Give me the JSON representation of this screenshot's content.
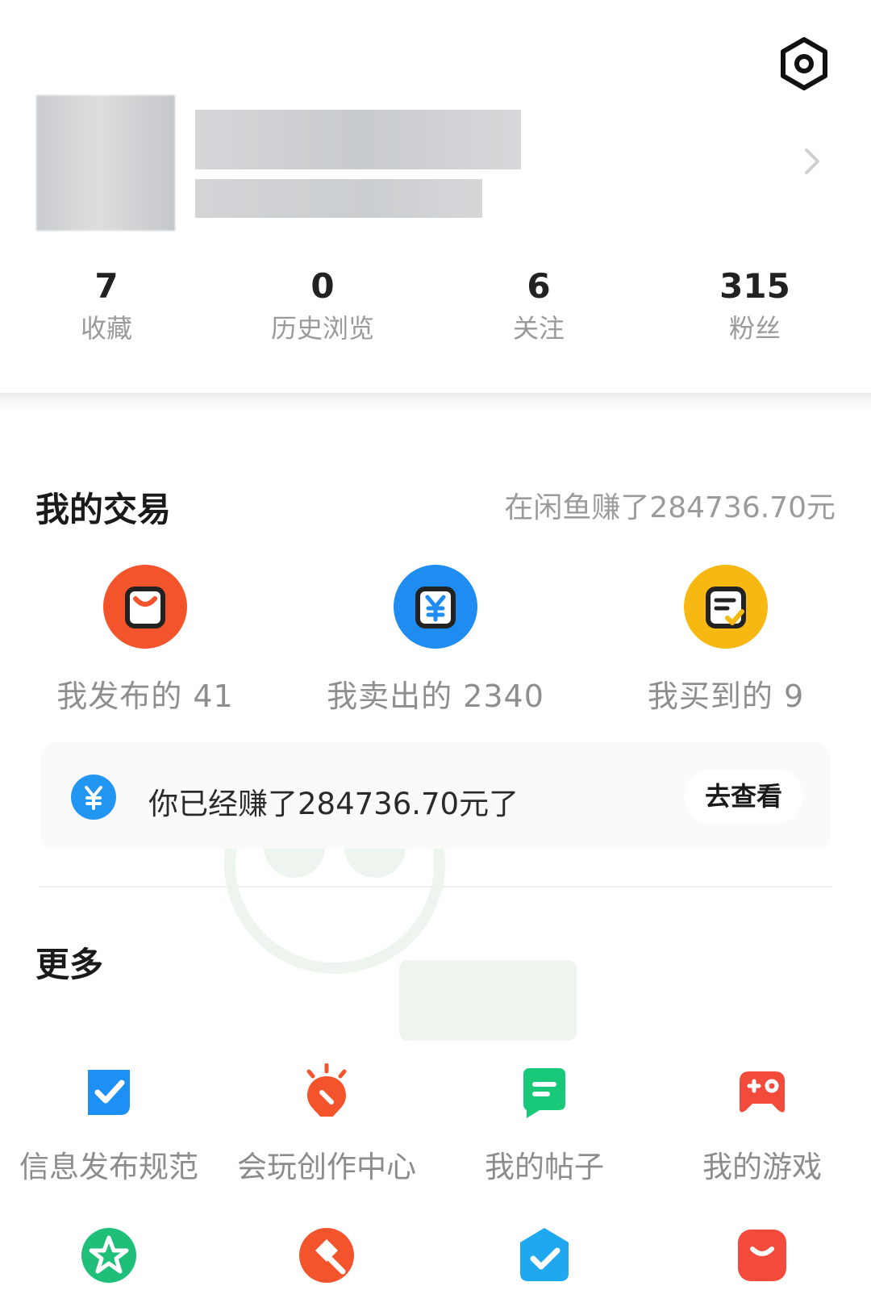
{
  "header": {
    "settings_icon": "settings-hex-icon"
  },
  "profile": {
    "chevron_icon": "chevron-right-icon"
  },
  "stats": [
    {
      "value": "7",
      "label": "收藏"
    },
    {
      "value": "0",
      "label": "历史浏览"
    },
    {
      "value": "6",
      "label": "关注"
    },
    {
      "value": "315",
      "label": "粉丝"
    }
  ],
  "trade": {
    "title": "我的交易",
    "earned_note": "在闲鱼赚了284736.70元",
    "items": [
      {
        "label": "我发布的 41",
        "icon": "bag-icon",
        "color": "#f4542c"
      },
      {
        "label": "我卖出的 2340",
        "icon": "yen-icon",
        "color": "#1e8cf0"
      },
      {
        "label": "我买到的 9",
        "icon": "receipt-icon",
        "color": "#f7b812"
      }
    ],
    "banner": {
      "text": "你已经赚了284736.70元了",
      "button": "去查看",
      "icon": "yen-circle-icon",
      "icon_color": "#2196f3"
    }
  },
  "more": {
    "title": "更多",
    "items": [
      {
        "label": "信息发布规范",
        "icon": "check-badge-icon",
        "color": "#1e90f5"
      },
      {
        "label": "会玩创作中心",
        "icon": "bulb-icon",
        "color": "#f4542c"
      },
      {
        "label": "我的帖子",
        "icon": "post-icon",
        "color": "#19c97a"
      },
      {
        "label": "我的游戏",
        "icon": "gamepad-icon",
        "color": "#f24b3c"
      },
      {
        "label": "",
        "icon": "star-badge-icon",
        "color": "#1fbf79"
      },
      {
        "label": "",
        "icon": "auction-icon",
        "color": "#f4542c"
      },
      {
        "label": "",
        "icon": "verified-icon",
        "color": "#1fa7f0"
      },
      {
        "label": "",
        "icon": "mailbox-icon",
        "color": "#f24b3c"
      }
    ]
  }
}
